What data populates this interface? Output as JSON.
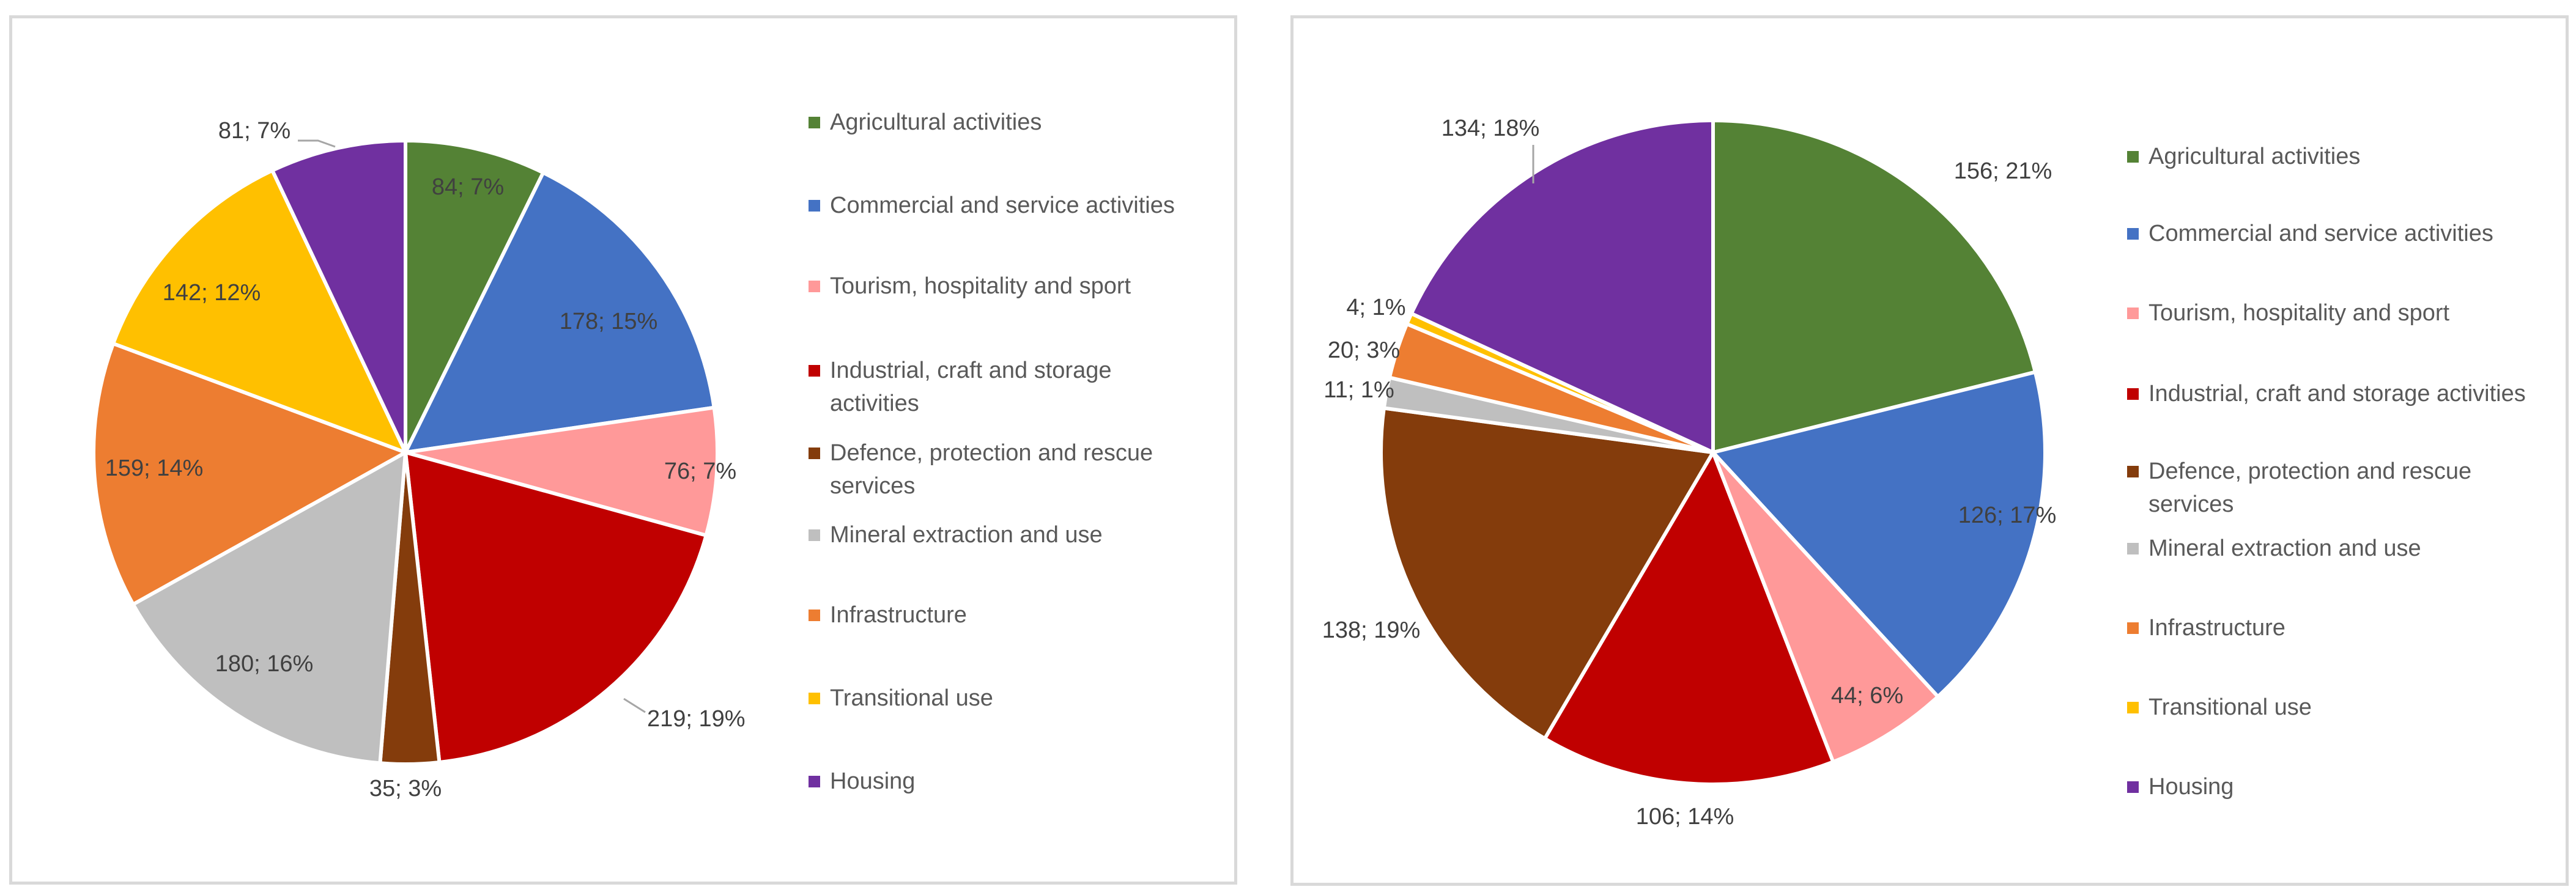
{
  "chart_data": [
    {
      "type": "pie",
      "title": "",
      "categories": [
        "Agricultural activities",
        "Commercial and service activities",
        "Tourism, hospitality and sport",
        "Industrial, craft and storage activities",
        "Defence, protection and rescue services",
        "Mineral extraction and use",
        "Infrastructure",
        "Transitional use",
        "Housing"
      ],
      "values": [
        84,
        178,
        76,
        219,
        35,
        180,
        159,
        142,
        81
      ],
      "percent_labels": [
        "7%",
        "15%",
        "7%",
        "19%",
        "3%",
        "16%",
        "14%",
        "12%",
        "7%"
      ],
      "data_labels": [
        "84; 7%",
        "178; 15%",
        "76; 7%",
        "219; 19%",
        "35; 3%",
        "180; 16%",
        "159; 14%",
        "142; 12%",
        "81; 7%"
      ],
      "start_angle": "12 o'clock, clockwise",
      "legend_position": "right"
    },
    {
      "type": "pie",
      "title": "",
      "categories": [
        "Agricultural activities",
        "Commercial and service activities",
        "Tourism, hospitality and sport",
        "Industrial, craft and storage activities",
        "Defence, protection and rescue services",
        "Mineral extraction and use",
        "Infrastructure",
        "Transitional use",
        "Housing"
      ],
      "values": [
        156,
        126,
        44,
        106,
        138,
        11,
        20,
        4,
        134
      ],
      "percent_labels": [
        "21%",
        "17%",
        "6%",
        "14%",
        "19%",
        "1%",
        "3%",
        "1%",
        "18%"
      ],
      "data_labels": [
        "156; 21%",
        "126; 17%",
        "44; 6%",
        "106; 14%",
        "138; 19%",
        "11; 1%",
        "20; 3%",
        "4; 1%",
        "134; 18%"
      ],
      "start_angle": "12 o'clock, clockwise",
      "legend_position": "right"
    }
  ],
  "colors": [
    "#548235",
    "#4472c4",
    "#ff9999",
    "#c00000",
    "#843c0c",
    "#bfbfbf",
    "#ed7d31",
    "#ffc000",
    "#7030a0"
  ],
  "legend": {
    "items": [
      {
        "label": "Agricultural activities",
        "icon": "square-swatch-icon"
      },
      {
        "label": "Commercial and service activities",
        "icon": "square-swatch-icon"
      },
      {
        "label": "Tourism, hospitality and sport",
        "icon": "square-swatch-icon"
      },
      {
        "label": "Industrial, craft and storage activities",
        "icon": "square-swatch-icon"
      },
      {
        "label": "Defence, protection and rescue services",
        "icon": "square-swatch-icon"
      },
      {
        "label": "Mineral extraction and use",
        "icon": "square-swatch-icon"
      },
      {
        "label": "Infrastructure",
        "icon": "square-swatch-icon"
      },
      {
        "label": "Transitional use",
        "icon": "square-swatch-icon"
      },
      {
        "label": "Housing",
        "icon": "square-swatch-icon"
      }
    ]
  }
}
